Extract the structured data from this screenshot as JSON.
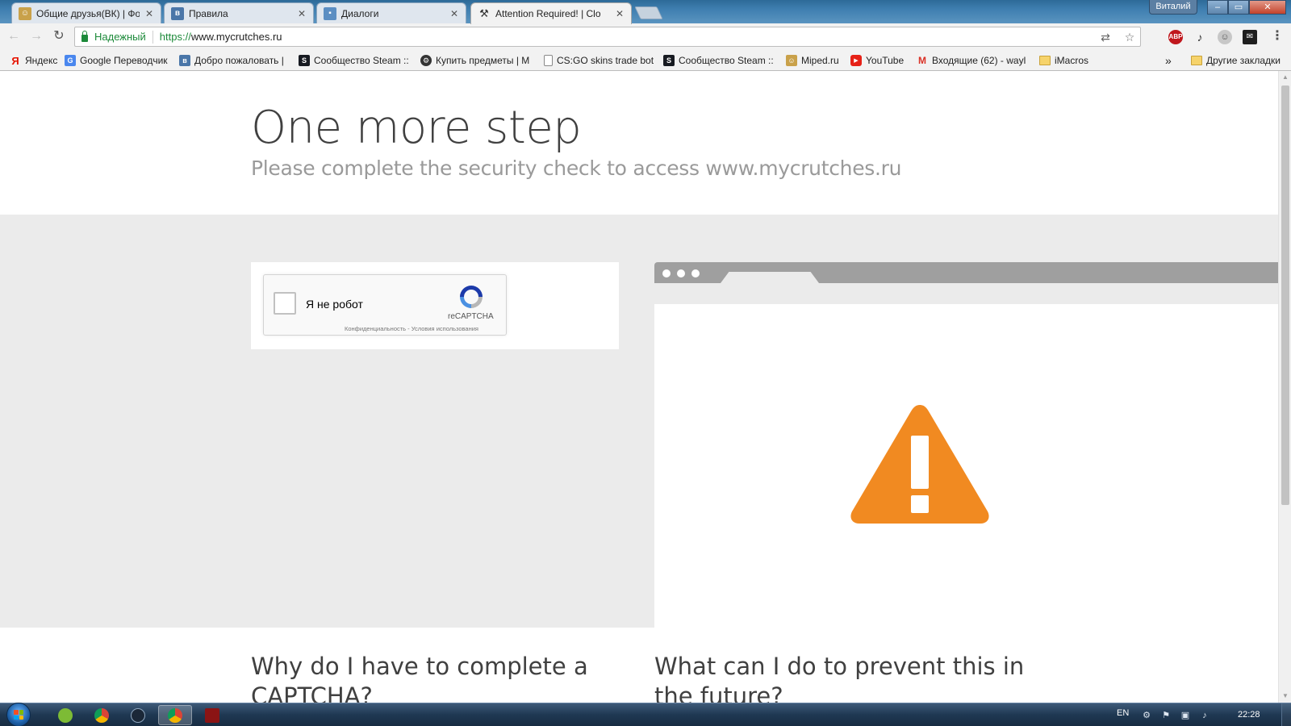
{
  "browser": {
    "tabs": [
      {
        "title": "Общие друзья(ВК) | Фор",
        "close": "✕"
      },
      {
        "title": "Правила",
        "close": "✕"
      },
      {
        "title": "Диалоги",
        "close": "✕"
      },
      {
        "title": "Attention Required! | Clo",
        "close": "✕"
      }
    ],
    "user_chip": "Виталий",
    "window_buttons": {
      "minimize": "–",
      "maximize": "▭",
      "close": "✕"
    },
    "security_label": "Надежный",
    "url_scheme": "https://",
    "url_host": "www.mycrutches.ru",
    "extensions": {
      "abp": "ABP"
    }
  },
  "bookmarks": {
    "items": [
      {
        "label": "Яндекс",
        "icon": "yandex-icon"
      },
      {
        "label": "Google Переводчик",
        "icon": "google-translate-icon"
      },
      {
        "label": "Добро пожаловать |",
        "icon": "vk-icon"
      },
      {
        "label": "Сообщество Steam ::",
        "icon": "steam-icon"
      },
      {
        "label": "Купить предметы | М",
        "icon": "market-icon"
      },
      {
        "label": "CS:GO skins trade bot",
        "icon": "page-icon"
      },
      {
        "label": "Сообщество Steam ::",
        "icon": "steam-icon"
      },
      {
        "label": "Miped.ru",
        "icon": "miped-icon"
      },
      {
        "label": "YouTube",
        "icon": "youtube-icon"
      },
      {
        "label": "Входящие (62) - wayl",
        "icon": "gmail-icon"
      },
      {
        "label": "iMacros",
        "icon": "folder-icon"
      }
    ],
    "overflow": "»",
    "other": "Другие закладки"
  },
  "page": {
    "title": "One more step",
    "subtitle": "Please complete the security check to access www.mycrutches.ru",
    "recaptcha": {
      "label": "Я не робот",
      "brand": "reCAPTCHA",
      "terms": "Конфиденциальность - Условия использования"
    },
    "why_heading": "Why do I have to complete a CAPTCHA?",
    "prevent_heading": "What can I do to prevent this in the future?"
  },
  "taskbar": {
    "language": "EN",
    "time": "22:28"
  },
  "colors": {
    "warning": "#f18a21",
    "secure_green": "#1d8a3a",
    "heading": "#404040",
    "subheading": "#9a9a9a"
  }
}
